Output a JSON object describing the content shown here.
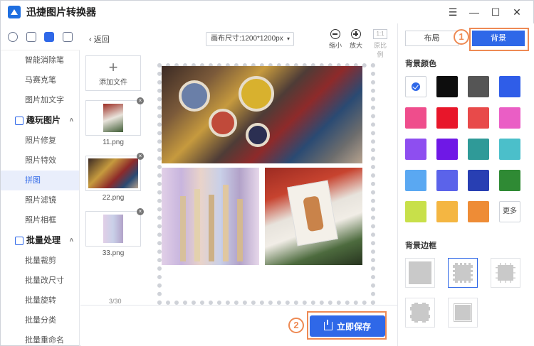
{
  "app": {
    "title": "迅捷图片转换器"
  },
  "window_controls": {
    "menu": "☰",
    "minimize": "—",
    "maximize": "☐",
    "close": "✕"
  },
  "sidebar": {
    "items_top": [
      {
        "label": "智能消除笔"
      },
      {
        "label": "马赛克笔"
      },
      {
        "label": "图片加文字"
      }
    ],
    "section_fun": {
      "label": "趣玩图片",
      "chevron": "˄"
    },
    "items_fun": [
      {
        "label": "照片修复"
      },
      {
        "label": "照片特效"
      },
      {
        "label": "拼图",
        "active": true
      },
      {
        "label": "照片滤镜"
      },
      {
        "label": "照片相框"
      }
    ],
    "section_batch": {
      "label": "批量处理",
      "chevron": "˄"
    },
    "items_batch": [
      {
        "label": "批量裁剪"
      },
      {
        "label": "批量改尺寸"
      },
      {
        "label": "批量旋转"
      },
      {
        "label": "批量分类"
      },
      {
        "label": "批量重命名"
      }
    ]
  },
  "files": {
    "back": "返回",
    "add_file": "添加文件",
    "list": [
      {
        "name": "11.png"
      },
      {
        "name": "22.png"
      },
      {
        "name": "33.png"
      }
    ],
    "count": "3/30"
  },
  "canvas": {
    "size_label": "画布尺寸:1200*1200px",
    "zoom_out": "缩小",
    "zoom_in": "放大",
    "original_box": "1:1",
    "original": "原比例"
  },
  "actions": {
    "save": "立即保存"
  },
  "panel": {
    "tab_layout": "布局",
    "tab_background": "背景",
    "bg_color_title": "背景颜色",
    "more": "更多",
    "bg_border_title": "背景边框",
    "colors": [
      "#ffffff",
      "#0d0d0d",
      "#555555",
      "#2f5de8",
      "#ef4d8c",
      "#e8162a",
      "#e84a4a",
      "#ea5ec5",
      "#8e4ef0",
      "#6f18e6",
      "#2f9a98",
      "#4bbfca",
      "#5aa8f2",
      "#5b63ea",
      "#283fb3",
      "#2f8a34",
      "#c8e04a",
      "#f4b642",
      "#ee8c36"
    ]
  },
  "annotations": {
    "one": "1",
    "two": "2"
  },
  "accent": "#2f68e8",
  "highlight": "#ee8a54"
}
